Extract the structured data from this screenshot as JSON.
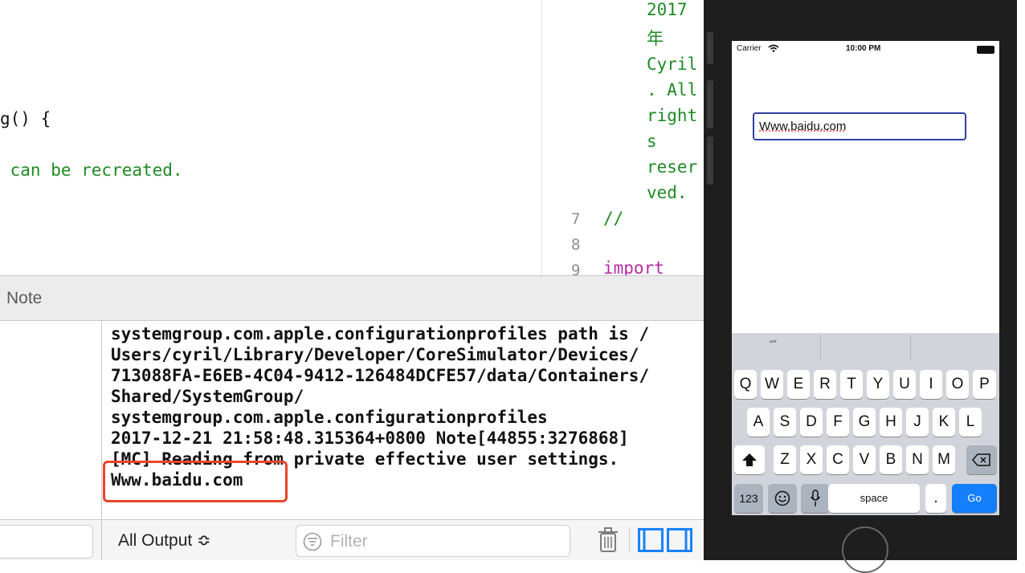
{
  "editor_left": {
    "lines": [
      {
        "text": "g() {",
        "color": "#111111"
      },
      {
        "text": " can be recreated.",
        "color": "#1e8a24"
      }
    ]
  },
  "editor_right": {
    "comment_fragments": [
      "2017",
      "年",
      "Cyril",
      ". All",
      "right",
      "s",
      "reser",
      "ved."
    ],
    "line_numbers": [
      "7",
      "8",
      "9"
    ],
    "lines": [
      {
        "num": "7",
        "text": "//"
      },
      {
        "num": "8",
        "text": ""
      },
      {
        "num": "9",
        "text": "import"
      }
    ]
  },
  "debug_bar": {
    "title": "Note"
  },
  "console": {
    "lines": [
      "systemgroup.com.apple.configurationprofiles path is /",
      "Users/cyril/Library/Developer/CoreSimulator/Devices/",
      "713088FA-E6EB-4C04-9412-126484DCFE57/data/Containers/",
      "Shared/SystemGroup/",
      "systemgroup.com.apple.configurationprofiles",
      "2017-12-21 21:58:48.315364+0800 Note[44855:3276868]",
      "[MC] Reading from private effective user settings.",
      "Www.baidu.com"
    ]
  },
  "console_footer": {
    "output_select": "All Output ≎",
    "filter_placeholder": "Filter"
  },
  "simulator": {
    "status": {
      "carrier": "Carrier",
      "time": "10:00 PM"
    },
    "text_field_value": "Www.baidu.com",
    "suggestion": "“”",
    "keyboard": {
      "row1": [
        "Q",
        "W",
        "E",
        "R",
        "T",
        "Y",
        "U",
        "I",
        "O",
        "P"
      ],
      "row2": [
        "A",
        "S",
        "D",
        "F",
        "G",
        "H",
        "J",
        "K",
        "L"
      ],
      "row3": [
        "Z",
        "X",
        "C",
        "V",
        "B",
        "N",
        "M"
      ],
      "numbers_key": "123",
      "space_key": "space",
      "period_key": ".",
      "go_key": "Go"
    }
  }
}
